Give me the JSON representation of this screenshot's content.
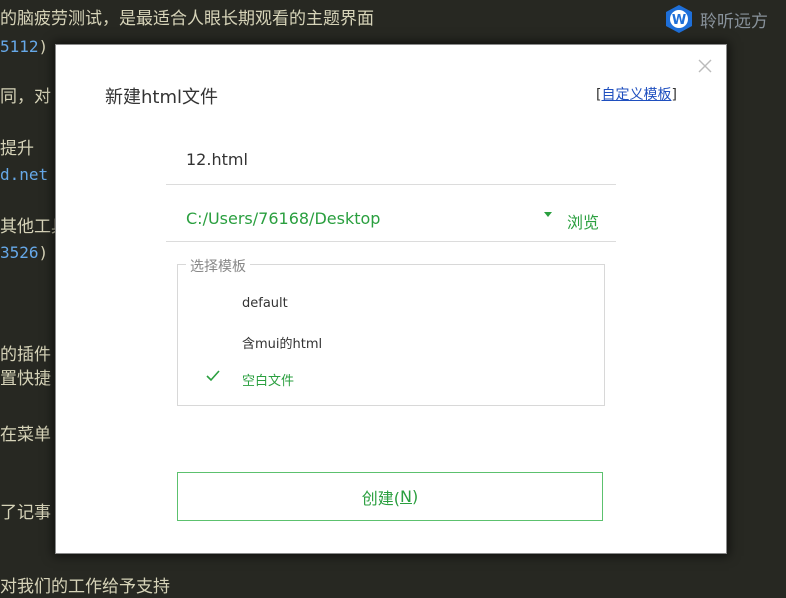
{
  "background": {
    "lines": [
      {
        "text": "的脑疲劳测试，是最适合人眼长期观看的主题界面"
      },
      {
        "text": "5112",
        "suffix": ")"
      },
      {
        "text": "同，对"
      },
      {
        "text": "提升"
      },
      {
        "text": "d.net"
      },
      {
        "text": "其他工具"
      },
      {
        "text": "3526",
        "suffix": ")"
      },
      {
        "text": "的插件"
      },
      {
        "text": "置快捷"
      },
      {
        "text": "在菜单"
      },
      {
        "text": "了记事"
      },
      {
        "text": "对我们的工作给予支持"
      }
    ]
  },
  "watermark": {
    "text": "聆听远方",
    "logo_letter": "W",
    "logo_color": "#1e6fd9"
  },
  "dialog": {
    "title": "新建html文件",
    "custom_template_bracket_open": "[",
    "custom_template_link": "自定义模板",
    "custom_template_bracket_close": "]",
    "filename_value": "12.html",
    "path_value": "C:/Users/76168/Desktop",
    "browse_label": "浏览",
    "template_group_label": "选择模板",
    "templates": [
      {
        "label": "default",
        "selected": false
      },
      {
        "label": "含mui的html",
        "selected": false
      },
      {
        "label": "空白文件",
        "selected": true
      }
    ],
    "create_label": "创建(",
    "create_key": "N",
    "create_label_end": ")"
  },
  "colors": {
    "accent": "#2a9f3f",
    "background": "#272822",
    "link": "#1f4fbf"
  }
}
